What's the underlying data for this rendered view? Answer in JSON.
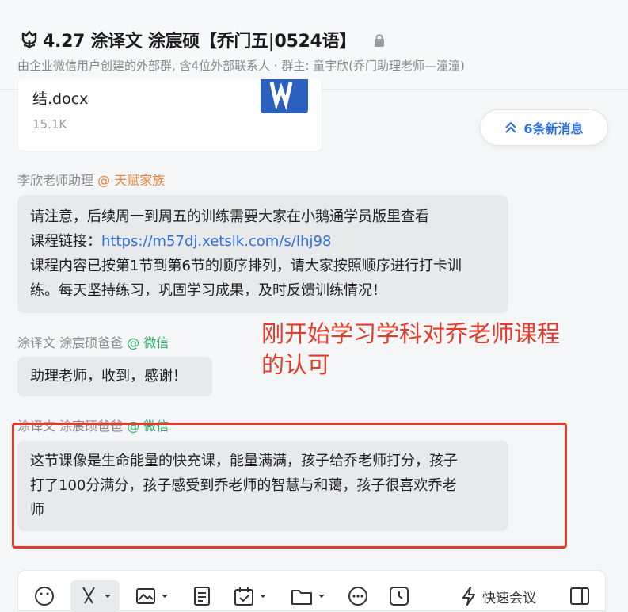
{
  "header": {
    "title": "4.27 涂译文 涂宸硕【乔门五|0524语】",
    "subtitle": "由企业微信用户创建的外部群, 含4位外部联系人 · 群主: 童宇欣(乔门助理老师—潼潼)"
  },
  "file_card": {
    "name": "结.docx",
    "size": "15.1K"
  },
  "new_messages": {
    "label": "6条新消息"
  },
  "messages": [
    {
      "sender": "李欣老师助理",
      "tag": "@ 天赋家族",
      "lines": [
        "请注意，后续周一到周五的训练需要大家在小鹅通学员版里查看",
        "课程链接：",
        "课程内容已按第1节到第6节的顺序排列，请大家按照顺序进行打卡训",
        "练。每天坚持练习，巩固学习成果，及时反馈训练情况！"
      ],
      "link": "https://m57dj.xetslk.com/s/Ihj98"
    },
    {
      "sender": "涂译文 涂宸硕爸爸",
      "tag": "@ 微信",
      "lines": [
        "助理老师，收到，感谢！"
      ]
    },
    {
      "sender": "涂译文 涂宸硕爸爸",
      "tag": "@ 微信",
      "lines": [
        "这节课像是生命能量的快充课，能量满满，孩子给乔老师打分，孩子",
        "打了100分满分，孩子感受到乔老师的智慧与和蔼，孩子很喜欢乔老",
        "师"
      ]
    }
  ],
  "annotation": {
    "line1": "刚开始学习学科对乔老师课程",
    "line2": "的认可",
    "color": "#e23b2a"
  },
  "toolbar": {
    "quick_meeting": "快速会议"
  },
  "colors": {
    "accent": "#2b6fe0",
    "bubble": "#e8e9eb",
    "tag_orange": "#e8813a",
    "tag_green": "#2aae67"
  }
}
